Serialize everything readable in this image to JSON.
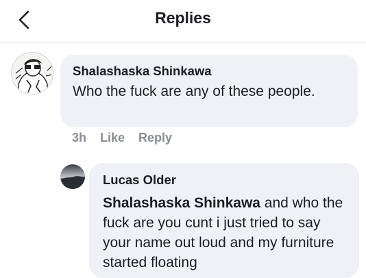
{
  "header": {
    "title": "Replies",
    "back_icon": "chevron-left-icon"
  },
  "comment": {
    "author": "Shalashaska Shinkawa",
    "text": "Who the fuck are any of these people.",
    "time": "3h",
    "like_label": "Like",
    "reply_label": "Reply"
  },
  "reply": {
    "author": "Lucas Older",
    "mention": "Shalashaska Shinkawa",
    "text": " and who the fuck are you cunt i just tried to say your name out loud and my furniture started floating"
  },
  "colors": {
    "bubble": "#eff1f6",
    "meta_text": "#8a8d91",
    "divider": "#e4e6eb"
  }
}
